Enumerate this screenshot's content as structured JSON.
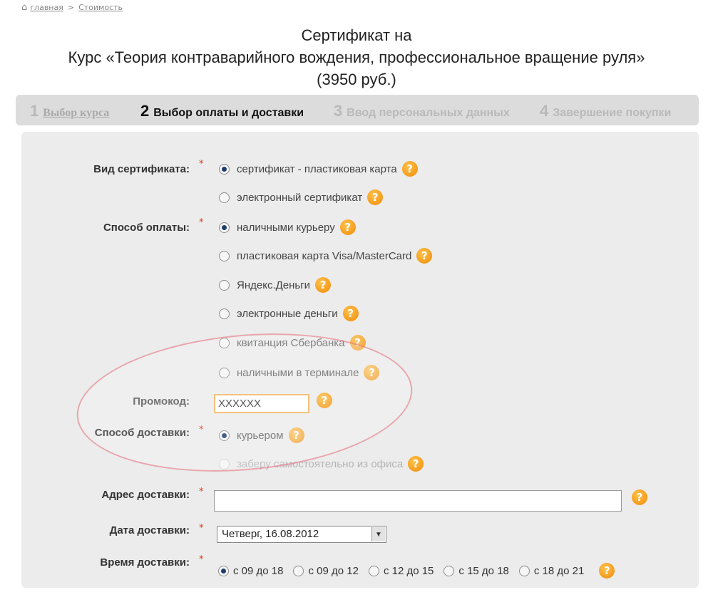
{
  "breadcrumb": {
    "home": "главная",
    "separator": ">",
    "current": "Стоимость"
  },
  "title": {
    "line1": "Сертификат на",
    "line2": "Курс «Теория контраварийного вождения, профессиональное вращение руля»",
    "line3": "(3950 руб.)"
  },
  "steps": [
    {
      "num": "1",
      "label": "Выбор курса"
    },
    {
      "num": "2",
      "label": "Выбор оплаты и доставки"
    },
    {
      "num": "3",
      "label": "Ввод персональных данных"
    },
    {
      "num": "4",
      "label": "Завершение покупки"
    }
  ],
  "form": {
    "required_mark": "*",
    "help_glyph": "?",
    "cert_type": {
      "label": "Вид сертификата:",
      "options": [
        "сертификат - пластиковая карта",
        "электронный сертификат"
      ],
      "selected": 0
    },
    "payment": {
      "label": "Способ оплаты:",
      "options": [
        "наличными курьеру",
        "пластиковая карта Visa/MasterCard",
        "Яндекс.Деньги",
        "электронные деньги",
        "квитанция Сбербанка",
        "наличными в терминале"
      ],
      "selected": 0
    },
    "promo": {
      "label": "Промокод:",
      "value": "XXXXXX"
    },
    "delivery": {
      "label": "Способ доставки:",
      "options": [
        "курьером",
        "заберу самостоятельно из офиса"
      ],
      "selected": 0
    },
    "address": {
      "label": "Адрес доставки:",
      "value": ""
    },
    "date": {
      "label": "Дата доставки:",
      "value": "Четверг, 16.08.2012",
      "arrow": "▼"
    },
    "time": {
      "label": "Время доставки:",
      "options": [
        "с 09 до 18",
        "с 09 до 12",
        "с 12 до 15",
        "с 15 до 18",
        "с 18 до 21"
      ],
      "selected": 0
    }
  },
  "colors": {
    "help_icon": "#f39a10",
    "required": "#e03a1a",
    "step_bar": "#dcdcdc",
    "panel": "#ececec",
    "highlight_ellipse": "#e26a74"
  }
}
